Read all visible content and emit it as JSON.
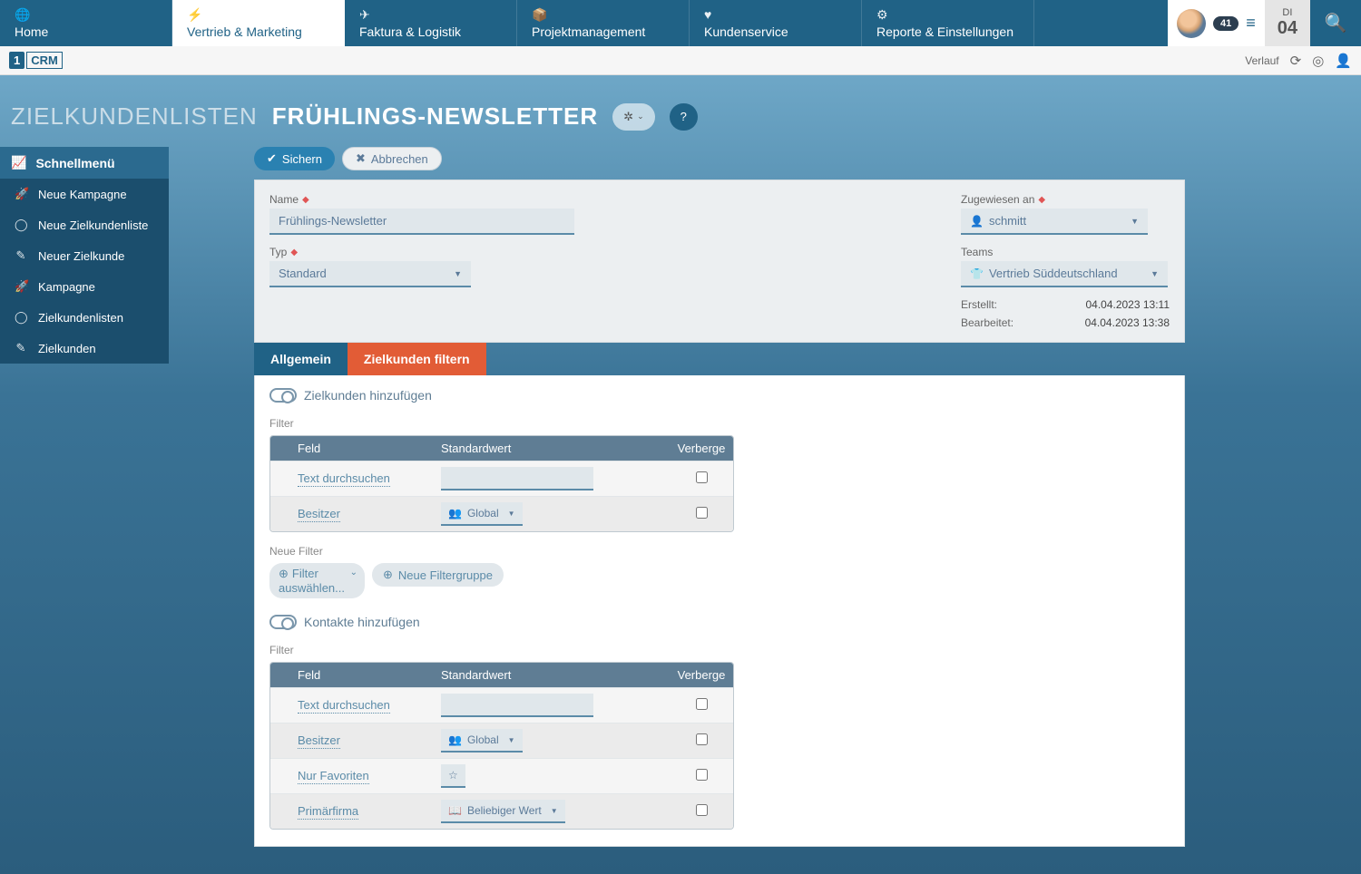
{
  "topnav": {
    "items": [
      {
        "label": "Home",
        "icon": "🌐"
      },
      {
        "label": "Vertrieb & Marketing",
        "icon": "⚡"
      },
      {
        "label": "Faktura & Logistik",
        "icon": "✈"
      },
      {
        "label": "Projektmanagement",
        "icon": "📦"
      },
      {
        "label": "Kundenservice",
        "icon": "♥"
      },
      {
        "label": "Reporte & Einstellungen",
        "icon": "⚙"
      }
    ],
    "badge": "41",
    "date_dow": "DI",
    "date_dom": "04"
  },
  "subbar": {
    "logo_prefix": "1",
    "logo_text": "CRM",
    "history": "Verlauf"
  },
  "title": {
    "crumb": "ZIELKUNDENLISTEN",
    "main": "FRÜHLINGS-NEWSLETTER"
  },
  "sidebar": {
    "heading": "Schnellmenü",
    "items": [
      {
        "label": "Neue Kampagne",
        "icon": "🚀"
      },
      {
        "label": "Neue Zielkundenliste",
        "icon": "◯"
      },
      {
        "label": "Neuer Zielkunde",
        "icon": "✎"
      },
      {
        "label": "Kampagne",
        "icon": "🚀"
      },
      {
        "label": "Zielkundenlisten",
        "icon": "◯"
      },
      {
        "label": "Zielkunden",
        "icon": "✎"
      }
    ]
  },
  "actions": {
    "save": "Sichern",
    "cancel": "Abbrechen"
  },
  "form": {
    "name_label": "Name",
    "name_value": "Frühlings-Newsletter",
    "type_label": "Typ",
    "type_value": "Standard",
    "assigned_label": "Zugewiesen an",
    "assigned_value": "schmitt",
    "teams_label": "Teams",
    "teams_value": "Vertrieb Süddeutschland",
    "created_label": "Erstellt:",
    "created_value": "04.04.2023 13:11",
    "modified_label": "Bearbeitet:",
    "modified_value": "04.04.2023 13:38"
  },
  "tabs": {
    "general": "Allgemein",
    "filter": "Zielkunden filtern"
  },
  "panel": {
    "toggle1": "Zielkunden hinzufügen",
    "toggle2": "Kontakte hinzufügen",
    "filter_label": "Filter",
    "new_filter_label": "Neue Filter",
    "col_field": "Feld",
    "col_default": "Standardwert",
    "col_hide": "Verberge",
    "rows1": [
      {
        "field": "Text durchsuchen",
        "type": "search"
      },
      {
        "field": "Besitzer",
        "type": "owner",
        "value": "Global"
      }
    ],
    "rows2": [
      {
        "field": "Text durchsuchen",
        "type": "search"
      },
      {
        "field": "Besitzer",
        "type": "owner",
        "value": "Global"
      },
      {
        "field": "Nur Favoriten",
        "type": "star"
      },
      {
        "field": "Primärfirma",
        "type": "company",
        "value": "Beliebiger Wert"
      }
    ],
    "add_filter_line1": "Filter",
    "add_filter_line2": "auswählen...",
    "add_group": "Neue Filtergruppe"
  }
}
